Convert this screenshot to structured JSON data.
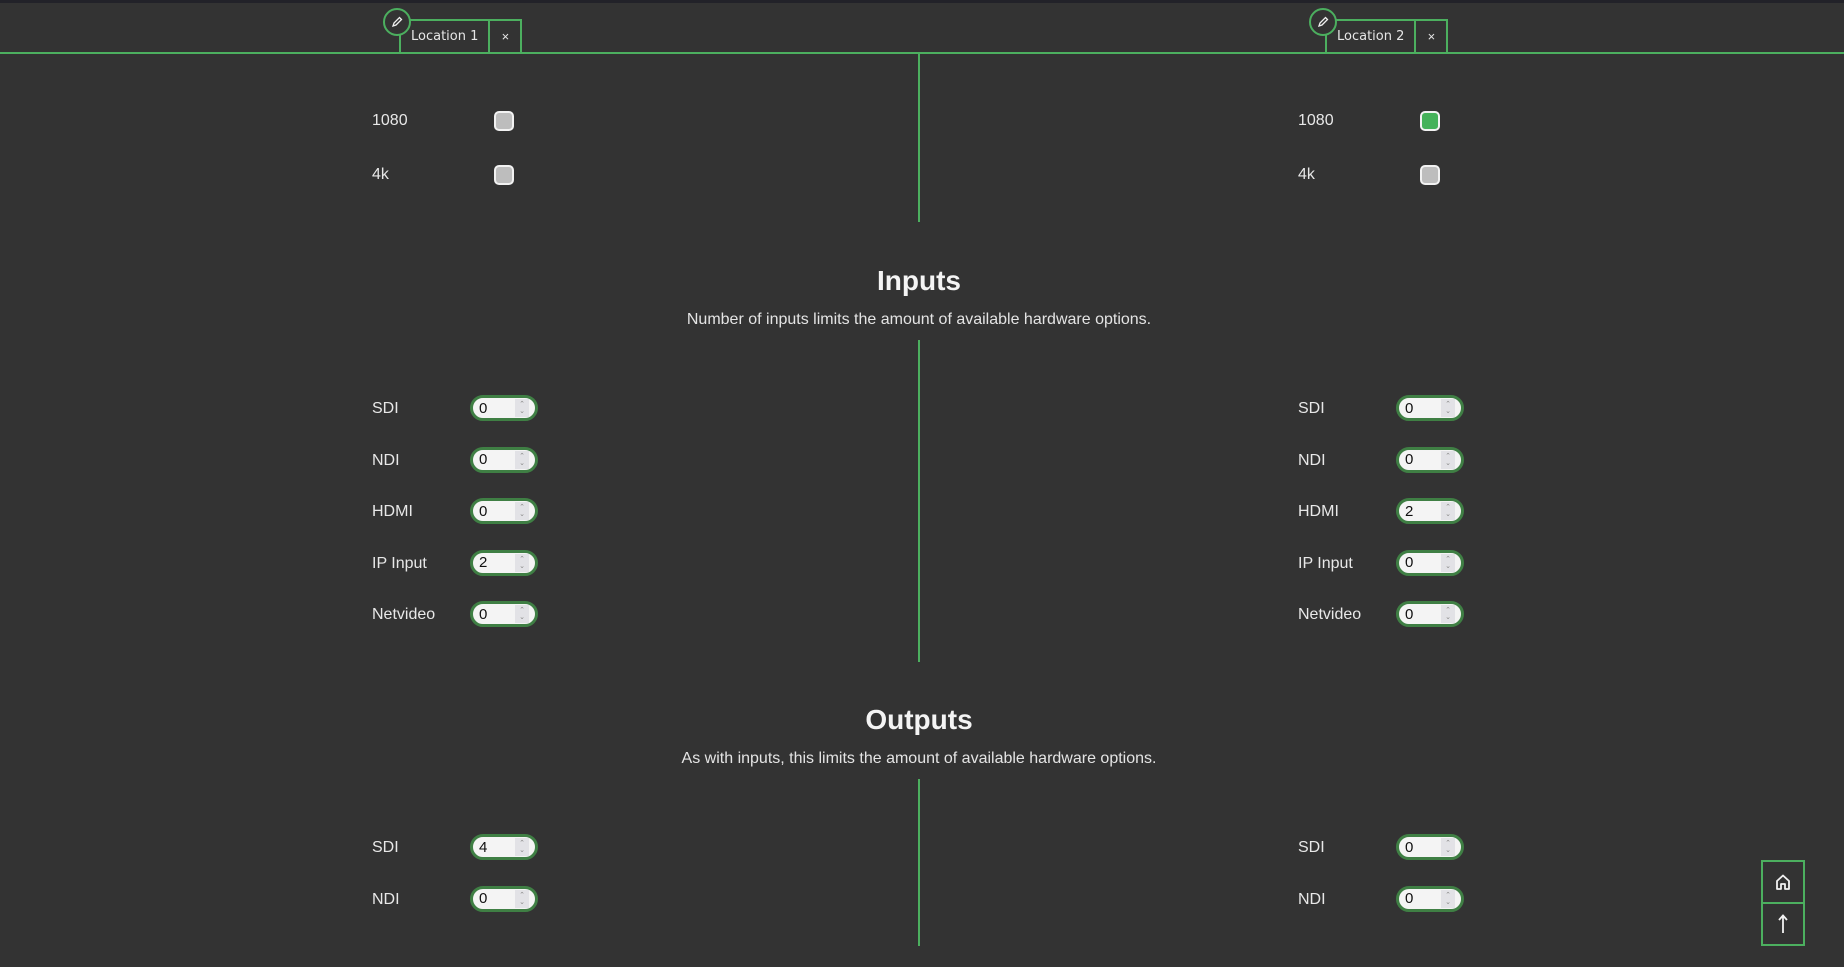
{
  "colors": {
    "accent": "#4caf5f",
    "background": "#333333",
    "checkbox_on": "#45b25a",
    "checkbox_off": "#bdbdbd"
  },
  "tabs": [
    {
      "label": "Location 1",
      "close": "×",
      "edit_icon": "pencil-icon"
    },
    {
      "label": "Location 2",
      "close": "×",
      "edit_icon": "pencil-icon"
    }
  ],
  "resolutions": {
    "location1": [
      {
        "label": "1080",
        "checked": false
      },
      {
        "label": "4k",
        "checked": false
      }
    ],
    "location2": [
      {
        "label": "1080",
        "checked": true
      },
      {
        "label": "4k",
        "checked": false
      }
    ]
  },
  "inputs": {
    "title": "Inputs",
    "subtitle": "Number of inputs limits the amount of available hardware options.",
    "location1": [
      {
        "label": "SDI",
        "value": "0"
      },
      {
        "label": "NDI",
        "value": "0"
      },
      {
        "label": "HDMI",
        "value": "0"
      },
      {
        "label": "IP Input",
        "value": "2"
      },
      {
        "label": "Netvideo",
        "value": "0"
      }
    ],
    "location2": [
      {
        "label": "SDI",
        "value": "0"
      },
      {
        "label": "NDI",
        "value": "0"
      },
      {
        "label": "HDMI",
        "value": "2"
      },
      {
        "label": "IP Input",
        "value": "0"
      },
      {
        "label": "Netvideo",
        "value": "0"
      }
    ]
  },
  "outputs": {
    "title": "Outputs",
    "subtitle": "As with inputs, this limits the amount of available hardware options.",
    "location1": [
      {
        "label": "SDI",
        "value": "4"
      },
      {
        "label": "NDI",
        "value": "0"
      }
    ],
    "location2": [
      {
        "label": "SDI",
        "value": "0"
      },
      {
        "label": "NDI",
        "value": "0"
      }
    ]
  },
  "fab": {
    "home_icon": "home-icon",
    "up_icon": "arrow-up-icon"
  }
}
